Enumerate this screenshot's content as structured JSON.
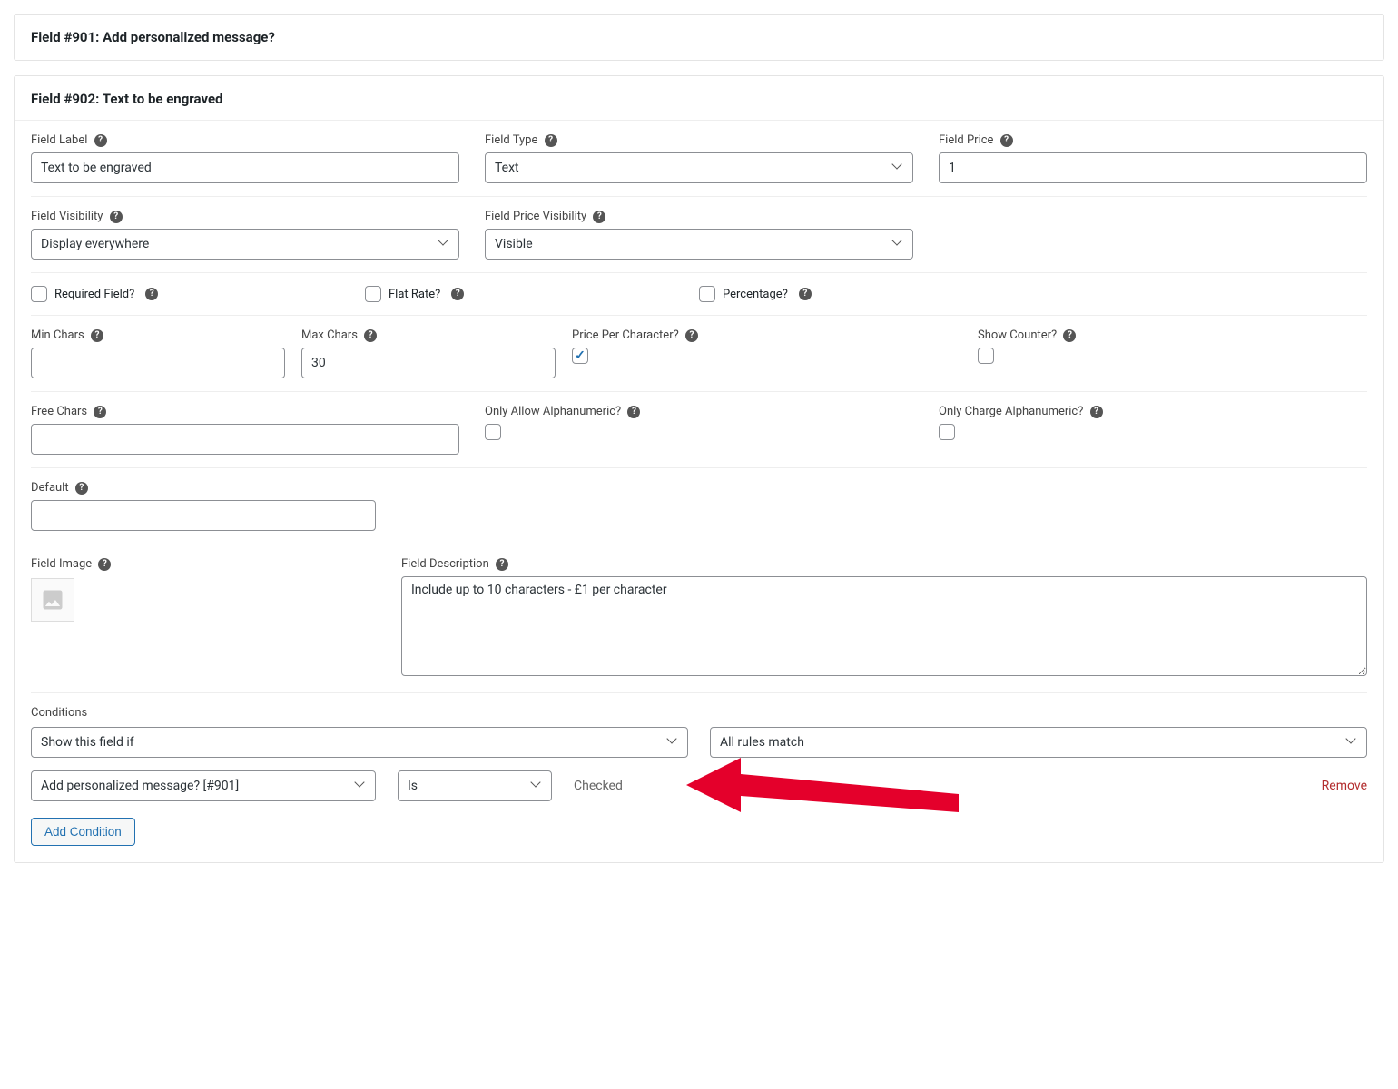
{
  "field901": {
    "title": "Field #901: Add personalized message?"
  },
  "field902": {
    "title": "Field #902: Text to be engraved",
    "labels": {
      "fieldLabel": "Field Label",
      "fieldType": "Field Type",
      "fieldPrice": "Field Price",
      "fieldVisibility": "Field Visibility",
      "fieldPriceVisibility": "Field Price Visibility",
      "requiredField": "Required Field?",
      "flatRate": "Flat Rate?",
      "percentage": "Percentage?",
      "minChars": "Min Chars",
      "maxChars": "Max Chars",
      "pricePerChar": "Price Per Character?",
      "showCounter": "Show Counter?",
      "freeChars": "Free Chars",
      "onlyAllowAlpha": "Only Allow Alphanumeric?",
      "onlyChargeAlpha": "Only Charge Alphanumeric?",
      "default": "Default",
      "fieldImage": "Field Image",
      "fieldDescription": "Field Description",
      "conditions": "Conditions",
      "addCondition": "Add Condition",
      "remove": "Remove"
    },
    "values": {
      "fieldLabel": "Text to be engraved",
      "fieldType": "Text",
      "fieldPrice": "1",
      "fieldVisibility": "Display everywhere",
      "fieldPriceVisibility": "Visible",
      "minChars": "",
      "maxChars": "30",
      "freeChars": "",
      "default": "",
      "fieldDescription": "Include up to 10 characters - £1 per character",
      "condAction": "Show this field if",
      "condMatch": "All rules match",
      "condField": "Add personalized message? [#901]",
      "condOp": "Is",
      "condValue": "Checked"
    }
  }
}
